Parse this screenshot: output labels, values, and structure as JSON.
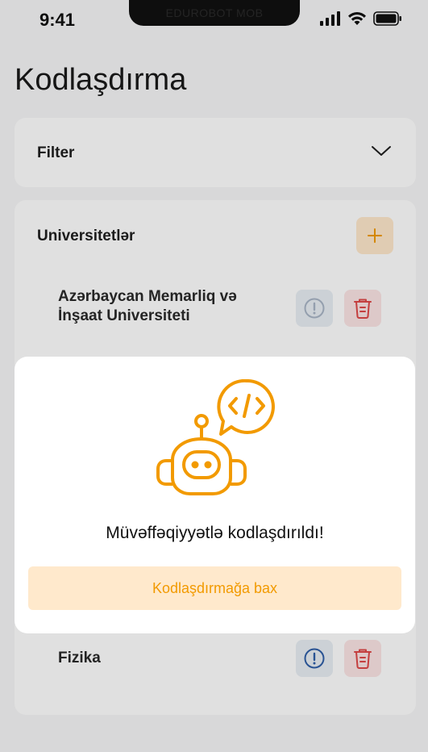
{
  "status_bar": {
    "time": "9:41",
    "notch_label": "EDUROBOT MOB"
  },
  "page": {
    "title": "Kodlaşdırma"
  },
  "filter": {
    "label": "Filter"
  },
  "universities": {
    "title": "Universitetlər",
    "items": [
      {
        "name": "Azərbaycan Memarliq və İnşaat Universiteti",
        "info_active": false
      },
      {
        "name": "Fizika",
        "info_active": true
      }
    ]
  },
  "modal": {
    "message": "Müvəffəqiyyətlə kodlaşdırıldı!",
    "button_label": "Kodlaşdırmağa bax"
  },
  "colors": {
    "accent": "#F29A00",
    "accent_light": "#FFE9CC",
    "danger": "#E04848",
    "info": "#2F5FA8"
  }
}
